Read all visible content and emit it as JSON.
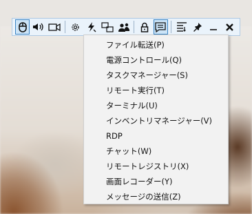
{
  "toolbar": {
    "buttons": [
      {
        "name": "mouse-icon",
        "active": true
      },
      {
        "name": "speaker-icon"
      },
      {
        "name": "video-icon"
      },
      {
        "name": "gear-icon"
      },
      {
        "name": "lightning-icon"
      },
      {
        "name": "monitor-switch-icon"
      },
      {
        "name": "users-icon"
      },
      {
        "name": "lock-icon"
      },
      {
        "name": "chat-icon",
        "active": true
      },
      {
        "name": "menu-list-icon"
      },
      {
        "name": "pin-icon"
      },
      {
        "name": "minimize-icon"
      },
      {
        "name": "close-icon"
      }
    ]
  },
  "menu": {
    "items": [
      "ファイル転送(P)",
      "電源コントロール(Q)",
      "タスクマネージャー(S)",
      "リモート実行(T)",
      "ターミナル(U)",
      "インベントリマネージャー(V)",
      "RDP",
      "チャット(W)",
      "リモートレジストリ(X)",
      "画面レコーダー(Y)",
      "メッセージの送信(Z)"
    ]
  }
}
